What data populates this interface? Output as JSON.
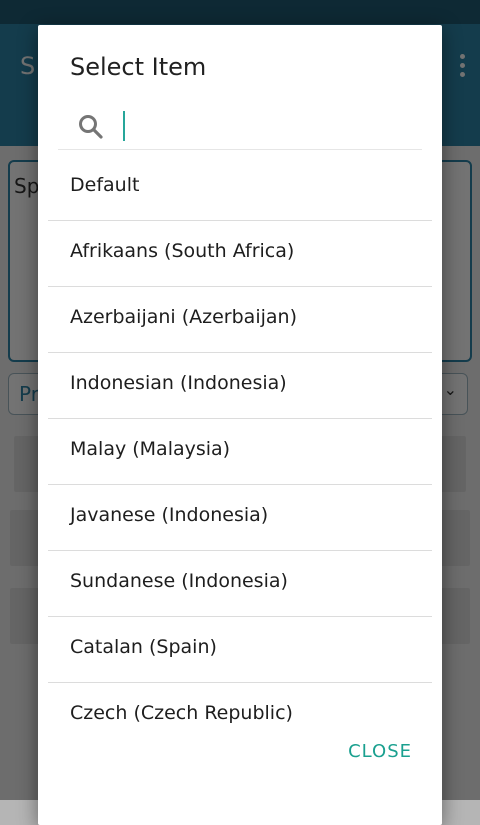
{
  "background_app": {
    "title_fragment": "S",
    "textarea_fragment": "Sp",
    "spinner_fragment": "Pr"
  },
  "dialog": {
    "title": "Select Item",
    "search": {
      "value": "",
      "placeholder": ""
    },
    "items": [
      "Default",
      "Afrikaans (South Africa)",
      "Azerbaijani (Azerbaijan)",
      "Indonesian (Indonesia)",
      "Malay (Malaysia)",
      "Javanese (Indonesia)",
      "Sundanese (Indonesia)",
      "Catalan (Spain)",
      "Czech (Czech Republic)"
    ],
    "close_label": "CLOSE"
  },
  "colors": {
    "toolbar": "#2e86a8",
    "accent": "#1aa08f",
    "cursor": "#26a69a"
  }
}
